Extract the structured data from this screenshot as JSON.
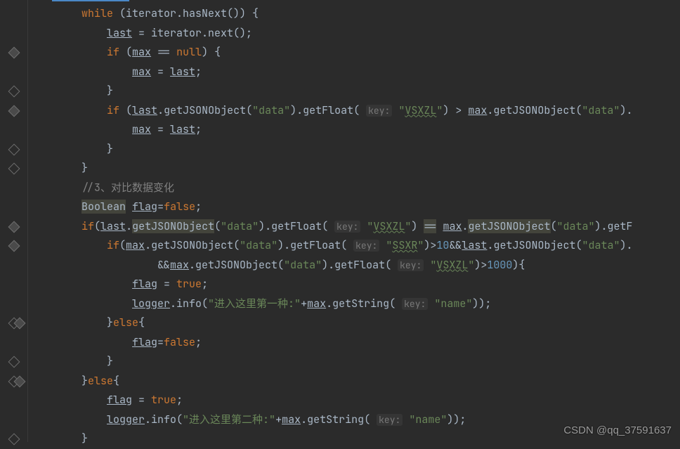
{
  "watermark": "CSDN @qq_37591637",
  "lines": {
    "l1": {
      "pre": "        ",
      "t": [
        [
          "kw",
          "while"
        ],
        [
          "",
          " (iterator.hasNext()) {"
        ]
      ]
    },
    "l2": {
      "pre": "            ",
      "t": [
        [
          "under",
          "last"
        ],
        [
          "",
          " = iterator.next();"
        ]
      ]
    },
    "l3": {
      "pre": "            ",
      "t": [
        [
          "kw",
          "if"
        ],
        [
          "",
          " ("
        ],
        [
          "under",
          "max"
        ],
        [
          "",
          " == "
        ],
        [
          "kw",
          "null"
        ],
        [
          "",
          ") {"
        ]
      ]
    },
    "l4": {
      "pre": "                ",
      "t": [
        [
          "under",
          "max"
        ],
        [
          "",
          " = "
        ],
        [
          "under",
          "last"
        ],
        [
          "",
          ";"
        ]
      ]
    },
    "l5": {
      "pre": "            ",
      "t": [
        [
          "",
          "}"
        ]
      ]
    },
    "l6": {
      "pre": "            ",
      "t": [
        [
          "kw",
          "if"
        ],
        [
          "",
          " ("
        ],
        [
          "under",
          "last"
        ],
        [
          "",
          ".getJSONObject("
        ],
        [
          "str",
          "\"data\""
        ],
        [
          "",
          ").getFloat( "
        ],
        [
          "hint",
          "key:"
        ],
        [
          "",
          " "
        ],
        [
          "str",
          "\""
        ],
        [
          "wavy str",
          "VSXZL"
        ],
        [
          "str",
          "\""
        ],
        [
          "",
          ") > "
        ],
        [
          "under",
          "max"
        ],
        [
          "",
          ".getJSONObject("
        ],
        [
          "str",
          "\"data\""
        ],
        [
          "",
          ")."
        ]
      ]
    },
    "l7": {
      "pre": "                ",
      "t": [
        [
          "under",
          "max"
        ],
        [
          "",
          " = "
        ],
        [
          "under",
          "last"
        ],
        [
          "",
          ";"
        ]
      ]
    },
    "l8": {
      "pre": "            ",
      "t": [
        [
          "",
          "}"
        ]
      ]
    },
    "l9": {
      "pre": "        ",
      "t": [
        [
          "",
          "}"
        ]
      ]
    },
    "l10": {
      "pre": "        ",
      "t": [
        [
          "comment",
          "//3、对比数据变化"
        ]
      ]
    },
    "l11": {
      "pre": "        ",
      "t": [
        [
          "hlbg",
          "Boolean"
        ],
        [
          "",
          " "
        ],
        [
          "under",
          "flag"
        ],
        [
          "",
          "="
        ],
        [
          "kw",
          "false"
        ],
        [
          "",
          ";"
        ]
      ]
    },
    "l12": {
      "pre": "        ",
      "t": [
        [
          "kw",
          "if"
        ],
        [
          "",
          "("
        ],
        [
          "under",
          "last"
        ],
        [
          "",
          "."
        ],
        [
          "hlbg",
          "getJSONObject"
        ],
        [
          "",
          "("
        ],
        [
          "str",
          "\"data\""
        ],
        [
          "",
          ").getFloat( "
        ],
        [
          "hint",
          "key:"
        ],
        [
          "",
          " "
        ],
        [
          "str",
          "\""
        ],
        [
          "wavy str",
          "VSXZL"
        ],
        [
          "str",
          "\""
        ],
        [
          "",
          ") "
        ],
        [
          "hlbg",
          "=="
        ],
        [
          "",
          " "
        ],
        [
          "under",
          "max"
        ],
        [
          "",
          "."
        ],
        [
          "hlbg",
          "getJSONObject"
        ],
        [
          "",
          "("
        ],
        [
          "str",
          "\"data\""
        ],
        [
          "",
          ").getF"
        ]
      ]
    },
    "l13": {
      "pre": "            ",
      "t": [
        [
          "kw",
          "if"
        ],
        [
          "",
          "("
        ],
        [
          "under",
          "max"
        ],
        [
          "",
          ".getJSONObject("
        ],
        [
          "str",
          "\"data\""
        ],
        [
          "",
          ").getFloat( "
        ],
        [
          "hint",
          "key:"
        ],
        [
          "",
          " "
        ],
        [
          "str",
          "\""
        ],
        [
          "wavy str",
          "SSXR"
        ],
        [
          "str",
          "\""
        ],
        [
          "",
          ")>"
        ],
        [
          "num",
          "10"
        ],
        [
          "",
          "&&"
        ],
        [
          "under",
          "last"
        ],
        [
          "",
          ".getJSONObject("
        ],
        [
          "str",
          "\"data\""
        ],
        [
          "",
          ")."
        ]
      ]
    },
    "l14": {
      "pre": "                    ",
      "t": [
        [
          "",
          "&&"
        ],
        [
          "under",
          "max"
        ],
        [
          "",
          ".getJSONObject("
        ],
        [
          "str",
          "\"data\""
        ],
        [
          "",
          ").getFloat( "
        ],
        [
          "hint",
          "key:"
        ],
        [
          "",
          " "
        ],
        [
          "str",
          "\""
        ],
        [
          "wavy str",
          "VSXZL"
        ],
        [
          "str",
          "\""
        ],
        [
          "",
          ")>"
        ],
        [
          "num",
          "1000"
        ],
        [
          "",
          "){"
        ]
      ]
    },
    "l15": {
      "pre": "                ",
      "t": [
        [
          "under",
          "flag"
        ],
        [
          "",
          " = "
        ],
        [
          "kw",
          "true"
        ],
        [
          "",
          ";"
        ]
      ]
    },
    "l16": {
      "pre": "                ",
      "t": [
        [
          "under",
          "logger"
        ],
        [
          "",
          ".info("
        ],
        [
          "str",
          "\"进入这里第一种:\""
        ],
        [
          "",
          "+"
        ],
        [
          "under",
          "max"
        ],
        [
          "",
          ".getString( "
        ],
        [
          "hint",
          "key:"
        ],
        [
          "",
          " "
        ],
        [
          "str",
          "\"name\""
        ],
        [
          "",
          "));"
        ]
      ]
    },
    "l17": {
      "pre": "            ",
      "t": [
        [
          "",
          "}"
        ],
        [
          "kw",
          "else"
        ],
        [
          "",
          "{"
        ]
      ]
    },
    "l18": {
      "pre": "                ",
      "t": [
        [
          "under",
          "flag"
        ],
        [
          "",
          "="
        ],
        [
          "kw",
          "false"
        ],
        [
          "",
          ";"
        ]
      ]
    },
    "l19": {
      "pre": "            ",
      "t": [
        [
          "",
          "}"
        ]
      ]
    },
    "l20": {
      "pre": "        ",
      "t": [
        [
          "",
          "}"
        ],
        [
          "kw",
          "else"
        ],
        [
          "",
          "{"
        ]
      ]
    },
    "l21": {
      "pre": "            ",
      "t": [
        [
          "under",
          "flag"
        ],
        [
          "",
          " = "
        ],
        [
          "kw",
          "true"
        ],
        [
          "",
          ";"
        ]
      ]
    },
    "l22": {
      "pre": "            ",
      "t": [
        [
          "under",
          "logger"
        ],
        [
          "",
          ".info("
        ],
        [
          "str",
          "\"进入这里第二种:\""
        ],
        [
          "",
          "+"
        ],
        [
          "under",
          "max"
        ],
        [
          "",
          ".getString( "
        ],
        [
          "hint",
          "key:"
        ],
        [
          "",
          " "
        ],
        [
          "str",
          "\"name\""
        ],
        [
          "",
          "));"
        ]
      ]
    },
    "l23": {
      "pre": "        ",
      "t": [
        [
          "",
          "}"
        ]
      ]
    }
  },
  "gutterMarks": [
    {
      "row": 3,
      "type": "open"
    },
    {
      "row": 5,
      "type": "close"
    },
    {
      "row": 6,
      "type": "open"
    },
    {
      "row": 8,
      "type": "close"
    },
    {
      "row": 9,
      "type": "close"
    },
    {
      "row": 12,
      "type": "open"
    },
    {
      "row": 13,
      "type": "open"
    },
    {
      "row": 17,
      "type": "close"
    },
    {
      "row": 17,
      "type": "open",
      "off": 8
    },
    {
      "row": 19,
      "type": "close"
    },
    {
      "row": 20,
      "type": "close"
    },
    {
      "row": 20,
      "type": "open",
      "off": 8
    },
    {
      "row": 23,
      "type": "close"
    }
  ]
}
